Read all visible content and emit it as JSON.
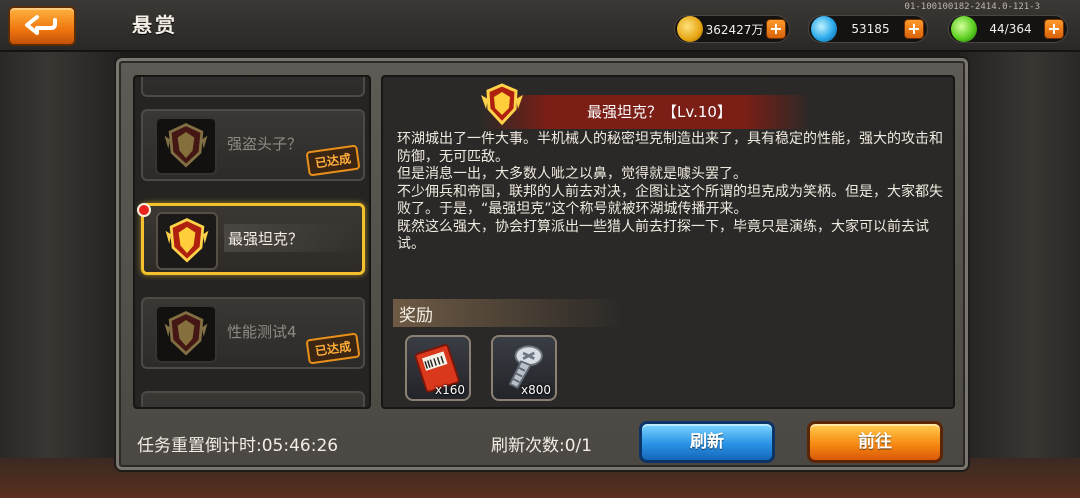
{
  "header": {
    "title": "悬赏",
    "version": "01-100100182-2414.0-121-3",
    "back_icon": "back-arrow-icon"
  },
  "resources": [
    {
      "name": "gold",
      "icon": "gold-coin-icon",
      "value": "362427万"
    },
    {
      "name": "diamond",
      "icon": "blue-gem-icon",
      "value": "53185"
    },
    {
      "name": "energy",
      "icon": "green-crystal-icon",
      "value": "44/364"
    }
  ],
  "plus_label": "+",
  "tasks": [
    {
      "name": "强盗头子？",
      "status": "已达成"
    },
    {
      "name": "最强坦克？",
      "status": ""
    },
    {
      "name": "性能测试4",
      "status": "已达成"
    }
  ],
  "detail": {
    "title": "最强坦克？【Lv.10】",
    "paragraphs": [
      "环湖城出了一件大事。半机械人的秘密坦克制造出来了，具有稳定的性能，强大的攻击和防御，无可匹敌。",
      "但是消息一出，大多数人呲之以鼻，觉得就是噱头罢了。",
      "不少佣兵和帝国，联邦的人前去对决，企图让这个所谓的坦克成为笑柄。但是，大家都失败了。于是，“最强坦克”这个称号就被环湖城传播开来。",
      "既然这么强大，协会打算派出一些猎人前去打探一下，毕竟只是演练，大家可以前去试试。"
    ]
  },
  "rewards": {
    "label": "奖励",
    "items": [
      {
        "icon": "ticket-coupon-icon",
        "qty": "x160"
      },
      {
        "icon": "screw-bolt-icon",
        "qty": "x800"
      }
    ]
  },
  "footer": {
    "timer": "任务重置倒计时:05:46:26",
    "refresh_count": "刷新次数:0/1",
    "refresh_button": "刷新",
    "go_button": "前往"
  },
  "colors": {
    "accent_orange": "#f0760e",
    "selected_border": "#f2c12c",
    "refresh_blue": "#2a93e6"
  }
}
